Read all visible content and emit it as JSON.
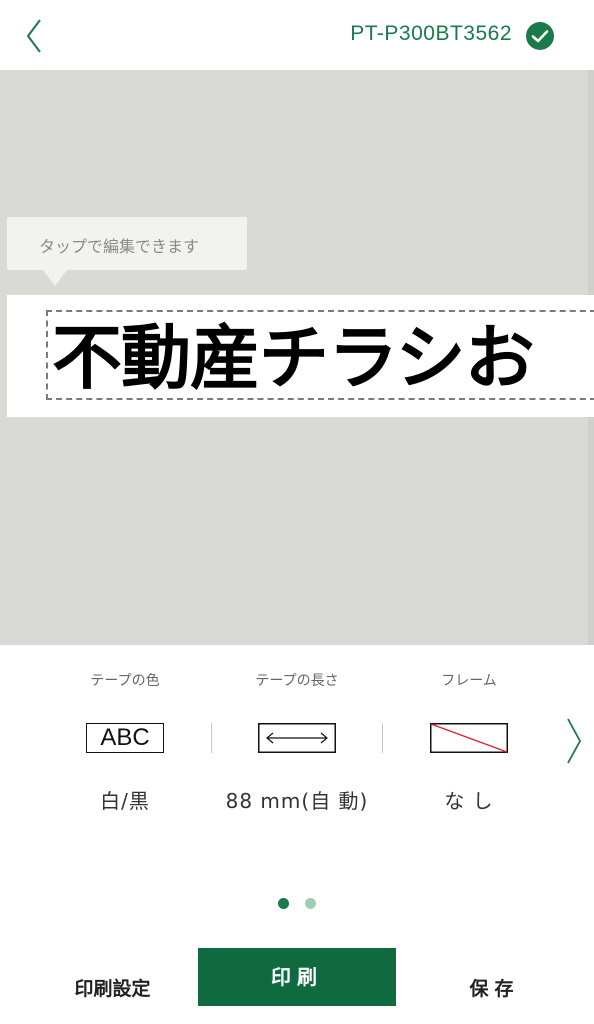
{
  "header": {
    "back_icon": "chevron-left-icon",
    "device_name": "PT-P300BT3562",
    "status_icon": "check-circle-icon",
    "accent_color": "#1a7a4c"
  },
  "canvas": {
    "tooltip": "タップで編集できます",
    "label_text": "不動産チラシお"
  },
  "settings": {
    "items": [
      {
        "label": "テープの色",
        "icon_text": "ABC",
        "value": "白/黒"
      },
      {
        "label": "テープの長さ",
        "icon": "double-arrow-icon",
        "value": "88 mm(自 動)"
      },
      {
        "label": "フレーム",
        "icon": "no-frame-icon",
        "value": "な し"
      }
    ],
    "next_icon": "chevron-right-icon",
    "pagination": {
      "active": 1,
      "total": 2
    }
  },
  "bottom_bar": {
    "print_settings": "印刷設定",
    "print": "印刷",
    "save": "保存",
    "print_bg_color": "#0f6a3f"
  }
}
